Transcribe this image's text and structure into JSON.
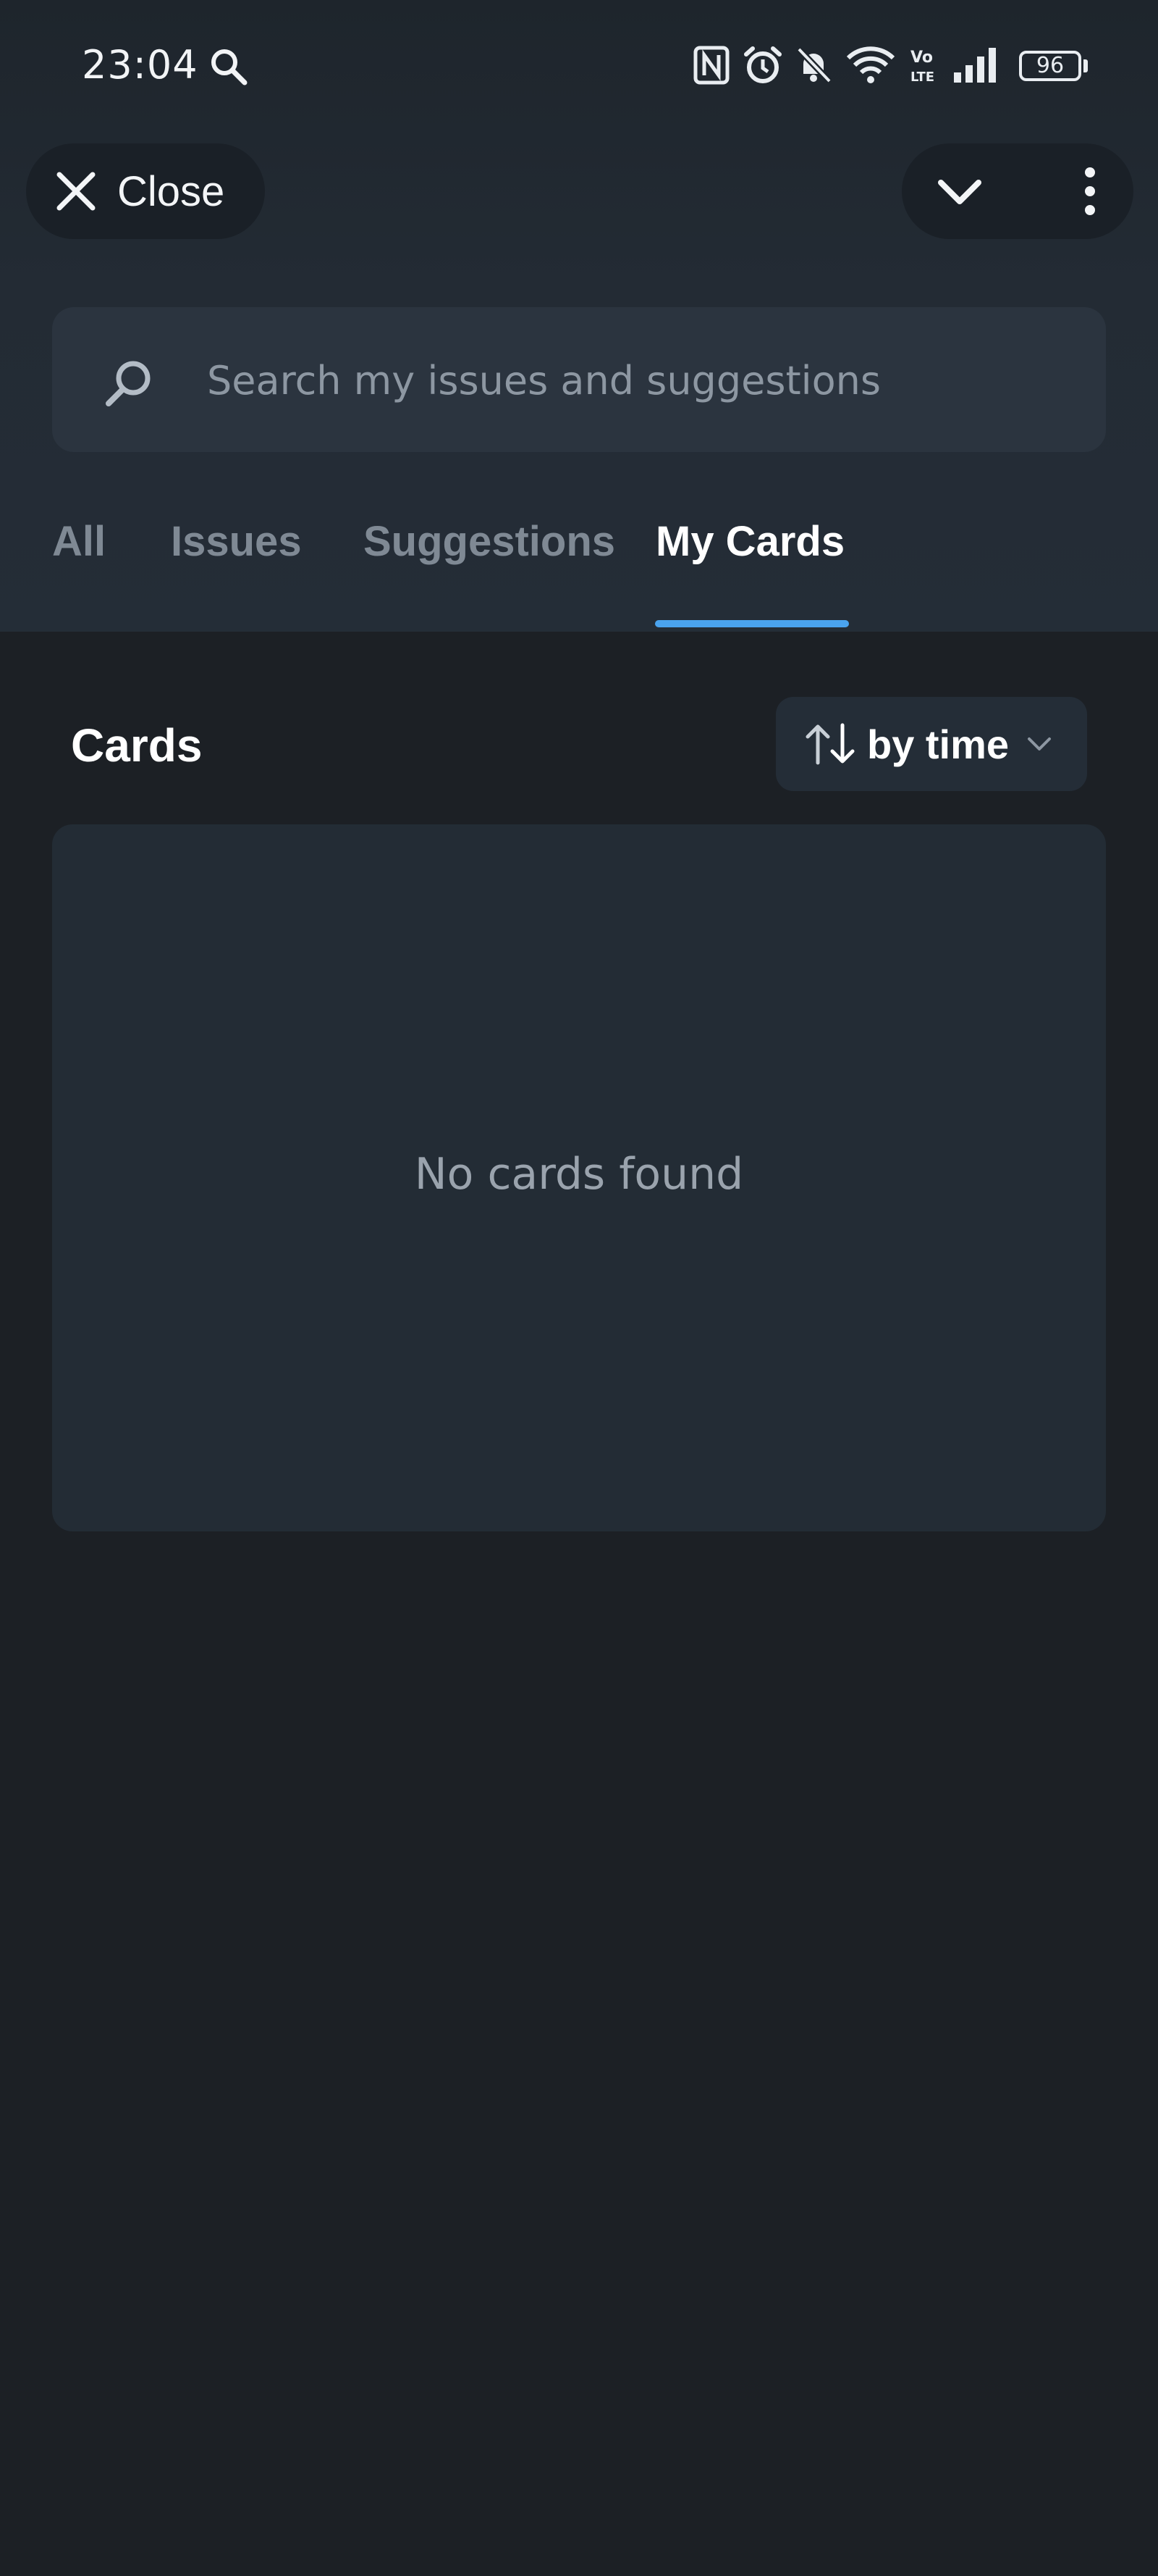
{
  "status_bar": {
    "time": "23:04",
    "battery": "96",
    "icons": [
      "search-icon",
      "nfc-icon",
      "alarm-icon",
      "mute-bell-icon",
      "wifi-icon",
      "volte-icon",
      "signal-icon",
      "battery-icon"
    ]
  },
  "header": {
    "close_label": "Close",
    "icons": [
      "close-icon",
      "chevron-down-icon",
      "more-vertical-icon"
    ]
  },
  "search": {
    "placeholder": "Search my issues and suggestions"
  },
  "tabs": [
    {
      "label": "All",
      "active": false
    },
    {
      "label": "Issues",
      "active": false
    },
    {
      "label": "Suggestions",
      "active": false
    },
    {
      "label": "My Cards",
      "active": true
    }
  ],
  "cards_section": {
    "title": "Cards",
    "sort_label": "by time",
    "empty_message": "No cards found"
  },
  "colors": {
    "accent": "#4aa3ee",
    "background": "#1c2025",
    "surface": "#232c35"
  }
}
